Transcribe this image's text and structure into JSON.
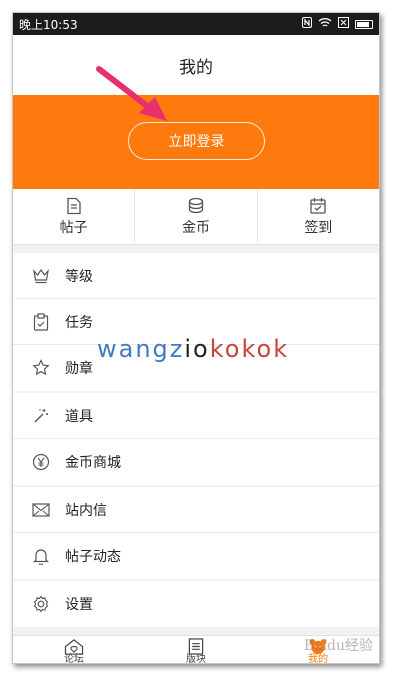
{
  "status_bar": {
    "time": "晚上10:53"
  },
  "header": {
    "title": "我的"
  },
  "hero": {
    "login_label": "立即登录"
  },
  "stats": [
    {
      "icon": "document-icon",
      "label": "帖子"
    },
    {
      "icon": "coins-icon",
      "label": "金币"
    },
    {
      "icon": "calendar-check-icon",
      "label": "签到"
    }
  ],
  "menu": {
    "group1": [
      {
        "icon": "crown-icon",
        "label": "等级"
      },
      {
        "icon": "clipboard-icon",
        "label": "任务"
      },
      {
        "icon": "medal-icon",
        "label": "勋章"
      }
    ],
    "group2": [
      {
        "icon": "magic-wand-icon",
        "label": "道具"
      },
      {
        "icon": "yen-coin-icon",
        "label": "金币商城"
      }
    ],
    "group3": [
      {
        "icon": "envelope-icon",
        "label": "站内信"
      },
      {
        "icon": "bell-icon",
        "label": "帖子动态"
      }
    ],
    "group4": [
      {
        "icon": "gear-icon",
        "label": "设置"
      }
    ]
  },
  "watermark": {
    "part1": "wangz",
    "part2": "io",
    "part3": "kokok"
  },
  "tabs": [
    {
      "icon": "heart-house-icon",
      "label": "论坛"
    },
    {
      "icon": "list-icon",
      "label": "版块"
    },
    {
      "icon": "bear-icon",
      "label": "我的"
    }
  ],
  "baidu_watermark": "Baidu经验",
  "colors": {
    "accent": "#ff7a0e",
    "status_bar": "#1c1c1c",
    "arrow": "#e8306e"
  }
}
